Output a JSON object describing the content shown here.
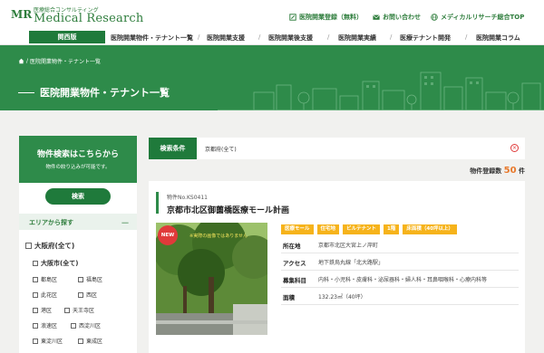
{
  "header": {
    "logo_mark": "MR",
    "logo_sub": "医療総合コンサルティング",
    "logo_main": "Medical Research",
    "links": [
      {
        "label": "医院開業登録（無料）",
        "icon": "edit-icon"
      },
      {
        "label": "お問い合わせ",
        "icon": "mail-icon"
      },
      {
        "label": "メディカルリサーチ総合TOP",
        "icon": "globe-icon"
      }
    ]
  },
  "nav": {
    "region": "関西版",
    "items": [
      "医院開業物件・テナント一覧",
      "医院開業支援",
      "医院開業後支援",
      "医院開業実績",
      "医療テナント開発",
      "医院開業コラム"
    ]
  },
  "banner": {
    "breadcrumb": "医院開業物件・テナント一覧",
    "title": "医院開業物件・テナント一覧"
  },
  "sidebar": {
    "head_title": "物件検索はこちらから",
    "head_sub": "物件の絞り込みが可能です。",
    "search_button": "検索",
    "area_title": "エリアから探す",
    "area_toggle": "－",
    "prefecture": "大阪府(全て)",
    "city": "大阪市(全て)",
    "wards": [
      "都島区",
      "福島区",
      "此花区",
      "西区",
      "港区",
      "天王寺区",
      "浪速区",
      "西淀川区",
      "東淀川区",
      "東成区"
    ]
  },
  "conditions": {
    "label": "検索条件",
    "value": "京都府(全て)",
    "clear": "×"
  },
  "result": {
    "label": "物件登録数",
    "count": "50",
    "unit": "件"
  },
  "property": {
    "number": "物件No.KS0411",
    "title": "京都市北区御薗橋医療モール計画",
    "badge": "NEW",
    "photo_caption": "※実際の画像ではありません",
    "tags": [
      "医療モール",
      "住宅地",
      "ビルテナント",
      "1階",
      "床面積（40坪以上）"
    ],
    "details": [
      {
        "key": "所在地",
        "value": "京都市北区大宮上ノ岸町"
      },
      {
        "key": "アクセス",
        "value": "地下鉄烏丸線「北大路駅」"
      },
      {
        "key": "募集科目",
        "value": "内科・小児科・皮膚科・泌尿器科・婦人科・耳鼻咽喉科・心療内科等"
      },
      {
        "key": "面積",
        "value": "132.23㎡（40坪）"
      }
    ]
  },
  "colors": {
    "primary_green": "#2e8b4a",
    "dark_green": "#1f7a3b",
    "tag_yellow": "#f6b31b",
    "count_orange": "#e8792c"
  }
}
